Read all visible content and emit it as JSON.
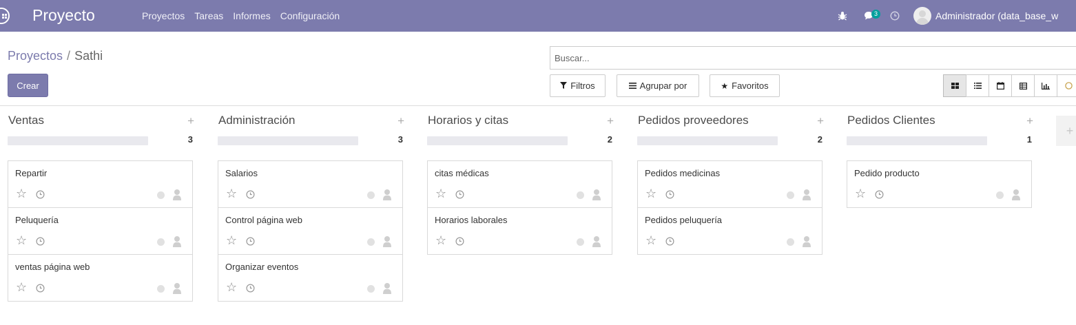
{
  "navbar": {
    "brand": "Proyecto",
    "menu": [
      "Proyectos",
      "Tareas",
      "Informes",
      "Configuración"
    ],
    "chat_badge": "3",
    "user": "Administrador (data_base_w"
  },
  "breadcrumb": {
    "parent": "Proyectos",
    "separator": "/",
    "current": "Sathi"
  },
  "actions": {
    "create": "Crear"
  },
  "search": {
    "placeholder": "Buscar..."
  },
  "filters": {
    "filters": "Filtros",
    "group_by": "Agrupar por",
    "favorites": "Favoritos"
  },
  "views": [
    "kanban",
    "list",
    "calendar",
    "pivot",
    "graph"
  ],
  "colors": {
    "navbar": "#7c7bad",
    "accent": "#7c7bad"
  },
  "columns": [
    {
      "title": "Ventas",
      "count": "3",
      "cards": [
        "Repartir",
        "Peluquería",
        "ventas página web"
      ]
    },
    {
      "title": "Administración",
      "count": "3",
      "cards": [
        "Salarios",
        "Control página web",
        "Organizar eventos"
      ]
    },
    {
      "title": "Horarios y citas",
      "count": "2",
      "cards": [
        "citas médicas",
        "Horarios laborales"
      ]
    },
    {
      "title": "Pedidos proveedores",
      "count": "2",
      "cards": [
        "Pedidos medicinas",
        "Pedidos peluquería"
      ]
    },
    {
      "title": "Pedidos Clientes",
      "count": "1",
      "cards": [
        "Pedido producto"
      ]
    }
  ],
  "add_column": "+"
}
